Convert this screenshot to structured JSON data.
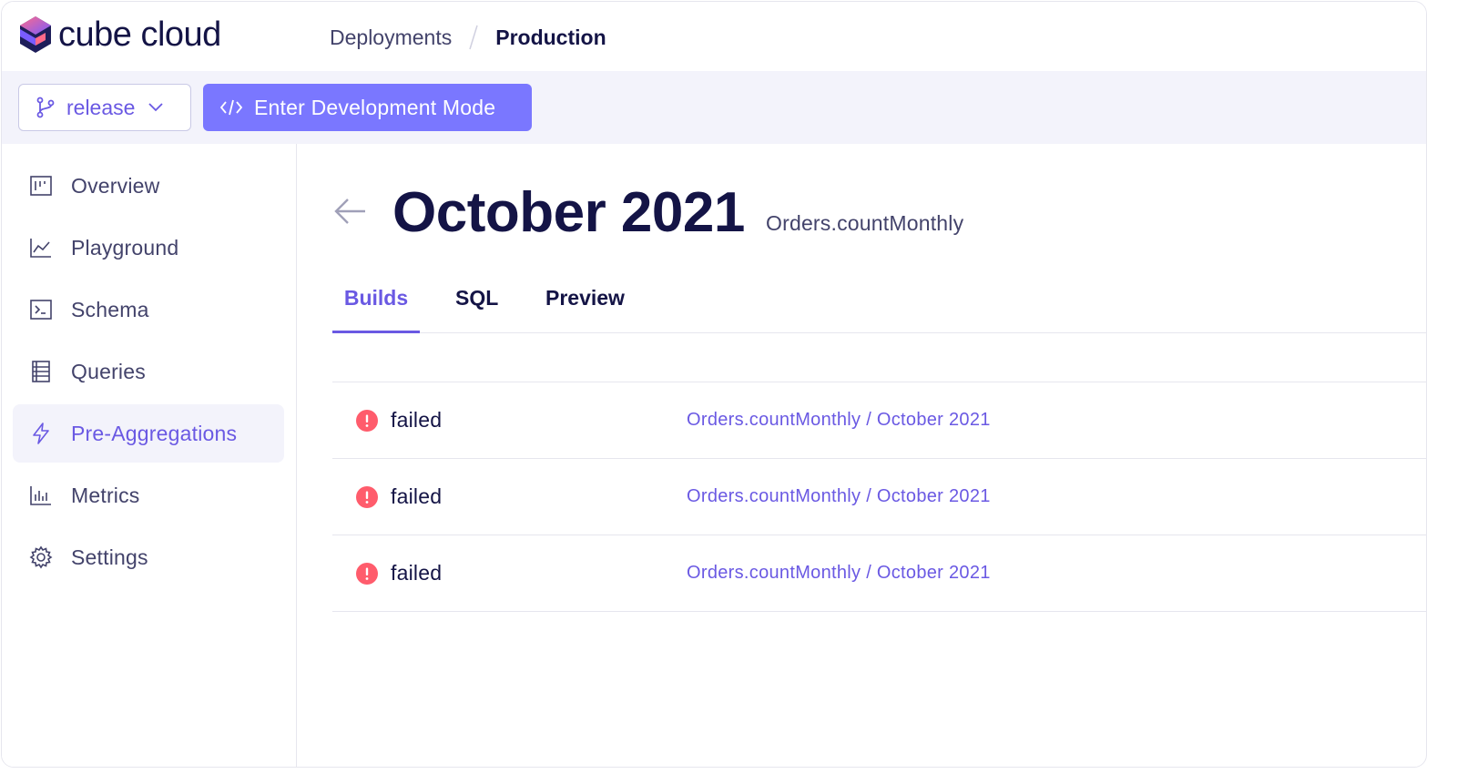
{
  "brand": {
    "name": "cube cloud",
    "icon": "cube-logo-icon"
  },
  "breadcrumb": {
    "parent": "Deployments",
    "current": "Production"
  },
  "toolbar": {
    "branch": {
      "label": "release",
      "icon": "git-branch-icon"
    },
    "dev_button": {
      "label": "Enter Development Mode",
      "icon": "code-icon"
    }
  },
  "sidebar": {
    "items": [
      {
        "label": "Overview",
        "icon": "overview-icon",
        "active": false
      },
      {
        "label": "Playground",
        "icon": "line-chart-icon",
        "active": false
      },
      {
        "label": "Schema",
        "icon": "terminal-icon",
        "active": false
      },
      {
        "label": "Queries",
        "icon": "list-icon",
        "active": false
      },
      {
        "label": "Pre-Aggregations",
        "icon": "lightning-icon",
        "active": true
      },
      {
        "label": "Metrics",
        "icon": "bar-chart-icon",
        "active": false
      },
      {
        "label": "Settings",
        "icon": "gear-icon",
        "active": false
      }
    ]
  },
  "main": {
    "title": "October 2021",
    "subtitle": "Orders.countMonthly",
    "tabs": [
      {
        "label": "Builds",
        "active": true
      },
      {
        "label": "SQL",
        "active": false
      },
      {
        "label": "Preview",
        "active": false
      }
    ],
    "builds": [
      {
        "status": "failed",
        "link": "Orders.countMonthly / October 2021"
      },
      {
        "status": "failed",
        "link": "Orders.countMonthly / October 2021"
      },
      {
        "status": "failed",
        "link": "Orders.countMonthly / October 2021"
      }
    ]
  },
  "colors": {
    "accent": "#6a59e3",
    "button": "#7a77ff",
    "error": "#ff5c6c",
    "text_dark": "#141446",
    "text_muted": "#43436b"
  }
}
